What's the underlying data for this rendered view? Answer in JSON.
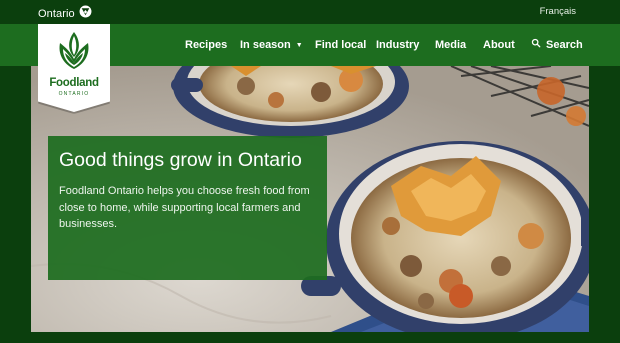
{
  "gov_bar": {
    "label": "Ontario",
    "icon": "ontario-trillium-icon",
    "language": "Français"
  },
  "logo": {
    "wordmark": "Foodland",
    "sub": "ONTARIO",
    "icon": "foodland-leaf-icon"
  },
  "nav": {
    "items": [
      {
        "label": "Recipes"
      },
      {
        "label": "In season",
        "has_dropdown": true
      },
      {
        "label": "Find local"
      },
      {
        "label": "Industry"
      },
      {
        "label": "Media"
      },
      {
        "label": "About"
      }
    ],
    "search": {
      "label": "Search",
      "icon": "search-icon"
    }
  },
  "hero": {
    "title": "Good things grow in Ontario",
    "description": "Foodland Ontario helps you choose fresh food from close to home, while supporting local farmers and businesses."
  },
  "colors": {
    "dark_green": "#0b3f0d",
    "nav_green": "#1d6d1f",
    "promo_green": "#1d6d1f",
    "white": "#ffffff"
  }
}
